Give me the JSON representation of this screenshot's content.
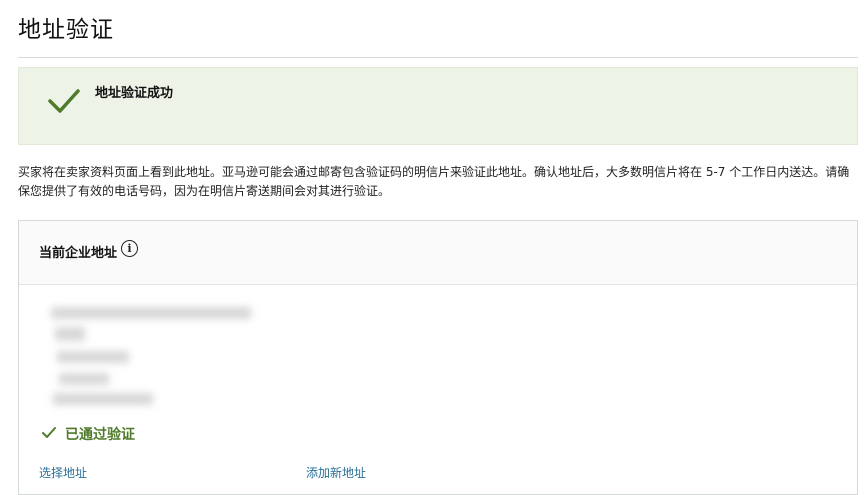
{
  "page": {
    "title": "地址验证"
  },
  "banner": {
    "message": "地址验证成功",
    "icon": "check-icon",
    "color": "#4e7a2a"
  },
  "info_text": "买家将在卖家资料页面上看到此地址。亚马逊可能会通过邮寄包含验证码的明信片来验证此地址。确认地址后，大多数明信片将在 5-7 个工作日内送达。请确保您提供了有效的电话号码，因为在明信片寄送期间会对其进行验证。",
  "card": {
    "title": "当前企业地址",
    "info_icon_glyph": "i",
    "verified_label": "已通过验证",
    "select_address_link": "选择地址",
    "add_address_link": "添加新地址"
  },
  "colors": {
    "banner_bg": "#eef3e8",
    "link": "#2a6f97",
    "verified": "#4e7a2a"
  }
}
